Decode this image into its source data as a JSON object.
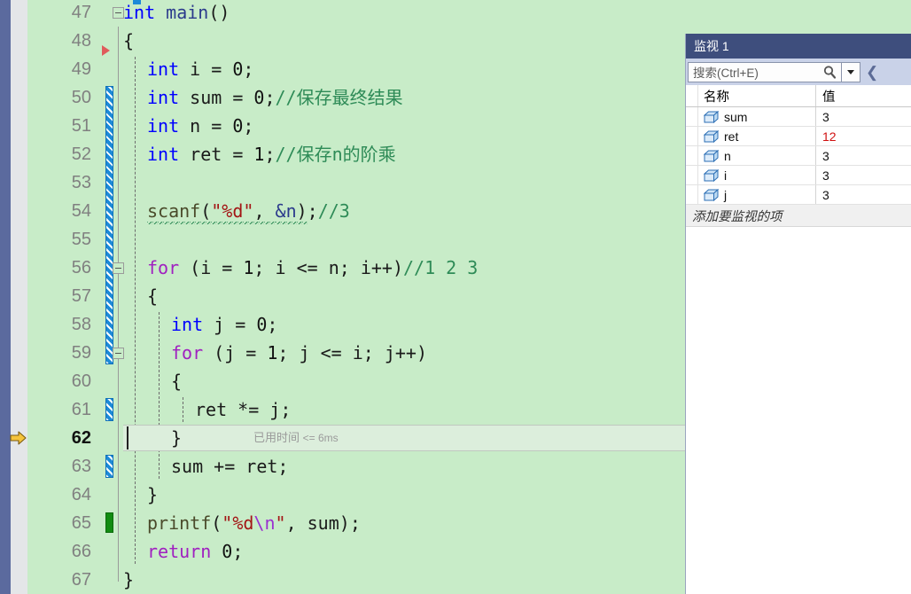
{
  "editor": {
    "first_line": 47,
    "current_line": 62,
    "elapsed_label": "已用时间",
    "elapsed_value": "<= 6ms",
    "colors": {
      "background": "#C8ECC8",
      "keyword": "#0000FF",
      "control_keyword": "#A020C0",
      "comment": "#2E8B57",
      "string": "#A31515",
      "line_number": "#808080",
      "current_line_highlight": "#DCEEDC"
    },
    "lines": [
      {
        "no": 47,
        "indent": 0,
        "tokens": [
          {
            "t": "int ",
            "c": "kw"
          },
          {
            "t": "main",
            "c": "ident"
          },
          {
            "t": "()",
            "c": "punct"
          }
        ]
      },
      {
        "no": 48,
        "indent": 0,
        "tokens": [
          {
            "t": "{",
            "c": "punct"
          }
        ]
      },
      {
        "no": 49,
        "indent": 1,
        "tokens": [
          {
            "t": "int",
            "c": "kw"
          },
          {
            "t": " i = ",
            "c": "punct"
          },
          {
            "t": "0",
            "c": "num"
          },
          {
            "t": ";",
            "c": "punct"
          }
        ]
      },
      {
        "no": 50,
        "indent": 1,
        "tokens": [
          {
            "t": "int",
            "c": "kw"
          },
          {
            "t": " sum = ",
            "c": "punct"
          },
          {
            "t": "0",
            "c": "num"
          },
          {
            "t": ";",
            "c": "punct"
          },
          {
            "t": "//保存最终结果",
            "c": "cmt"
          }
        ]
      },
      {
        "no": 51,
        "indent": 1,
        "tokens": [
          {
            "t": "int",
            "c": "kw"
          },
          {
            "t": " n = ",
            "c": "punct"
          },
          {
            "t": "0",
            "c": "num"
          },
          {
            "t": ";",
            "c": "punct"
          }
        ]
      },
      {
        "no": 52,
        "indent": 1,
        "tokens": [
          {
            "t": "int",
            "c": "kw"
          },
          {
            "t": " ret = ",
            "c": "punct"
          },
          {
            "t": "1",
            "c": "num"
          },
          {
            "t": ";",
            "c": "punct"
          },
          {
            "t": "//保存n的阶乘",
            "c": "cmt"
          }
        ]
      },
      {
        "no": 53,
        "indent": 1,
        "tokens": []
      },
      {
        "no": 54,
        "indent": 1,
        "tokens": [
          {
            "t": "scanf",
            "c": "fn squig"
          },
          {
            "t": "(",
            "c": "punct squig"
          },
          {
            "t": "\"%d\"",
            "c": "str squig"
          },
          {
            "t": ", ",
            "c": "punct squig"
          },
          {
            "t": "&n",
            "c": "ident squig"
          },
          {
            "t": ")",
            "c": "punct squig"
          },
          {
            "t": ";",
            "c": "punct"
          },
          {
            "t": "//3",
            "c": "cmt"
          }
        ]
      },
      {
        "no": 55,
        "indent": 1,
        "tokens": []
      },
      {
        "no": 56,
        "indent": 1,
        "tokens": [
          {
            "t": "for",
            "c": "kwctl"
          },
          {
            "t": " (i = ",
            "c": "punct"
          },
          {
            "t": "1",
            "c": "num"
          },
          {
            "t": "; i <= n; i++)",
            "c": "punct"
          },
          {
            "t": "//1 2 3",
            "c": "cmt"
          }
        ]
      },
      {
        "no": 57,
        "indent": 1,
        "tokens": [
          {
            "t": "{",
            "c": "punct"
          }
        ]
      },
      {
        "no": 58,
        "indent": 2,
        "tokens": [
          {
            "t": "int",
            "c": "kw"
          },
          {
            "t": " j = ",
            "c": "punct"
          },
          {
            "t": "0",
            "c": "num"
          },
          {
            "t": ";",
            "c": "punct"
          }
        ]
      },
      {
        "no": 59,
        "indent": 2,
        "tokens": [
          {
            "t": "for",
            "c": "kwctl"
          },
          {
            "t": " (j = ",
            "c": "punct"
          },
          {
            "t": "1",
            "c": "num"
          },
          {
            "t": "; j <= i; j++)",
            "c": "punct"
          }
        ]
      },
      {
        "no": 60,
        "indent": 2,
        "tokens": [
          {
            "t": "{",
            "c": "punct"
          }
        ]
      },
      {
        "no": 61,
        "indent": 3,
        "tokens": [
          {
            "t": "ret *= j;",
            "c": "punct"
          }
        ]
      },
      {
        "no": 62,
        "indent": 2,
        "tokens": [
          {
            "t": "}",
            "c": "punct"
          }
        ]
      },
      {
        "no": 63,
        "indent": 2,
        "tokens": [
          {
            "t": "sum += ret;",
            "c": "punct"
          }
        ]
      },
      {
        "no": 64,
        "indent": 1,
        "tokens": [
          {
            "t": "}",
            "c": "punct"
          }
        ]
      },
      {
        "no": 65,
        "indent": 1,
        "tokens": [
          {
            "t": "printf",
            "c": "fn"
          },
          {
            "t": "(",
            "c": "punct"
          },
          {
            "t": "\"%d",
            "c": "str"
          },
          {
            "t": "\\n",
            "c": "esc"
          },
          {
            "t": "\"",
            "c": "str"
          },
          {
            "t": ", sum)",
            "c": "punct"
          },
          {
            "t": ";",
            "c": "punct"
          }
        ]
      },
      {
        "no": 66,
        "indent": 1,
        "tokens": [
          {
            "t": "return",
            "c": "kwctl"
          },
          {
            "t": " ",
            "c": "punct"
          },
          {
            "t": "0",
            "c": "num"
          },
          {
            "t": ";",
            "c": "punct"
          }
        ]
      },
      {
        "no": 67,
        "indent": 0,
        "tokens": [
          {
            "t": "}",
            "c": "punct"
          }
        ]
      }
    ],
    "gutter": {
      "change_bars_blue": [
        50,
        51,
        52,
        53,
        54,
        55,
        56,
        57,
        58,
        59,
        61,
        63
      ],
      "change_bar_green": [
        65
      ],
      "bookmark_triangle_line": 48,
      "fold_boxes": [
        47,
        56,
        59
      ],
      "execution_arrow_line": 62
    }
  },
  "watch": {
    "title": "监视 1",
    "search_placeholder": "搜索(Ctrl+E)",
    "columns": [
      "名称",
      "值"
    ],
    "rows": [
      {
        "name": "sum",
        "value": "3",
        "changed": false
      },
      {
        "name": "ret",
        "value": "12",
        "changed": true
      },
      {
        "name": "n",
        "value": "3",
        "changed": false
      },
      {
        "name": "i",
        "value": "3",
        "changed": false
      },
      {
        "name": "j",
        "value": "3",
        "changed": false
      }
    ],
    "add_item_label": "添加要监视的项"
  }
}
